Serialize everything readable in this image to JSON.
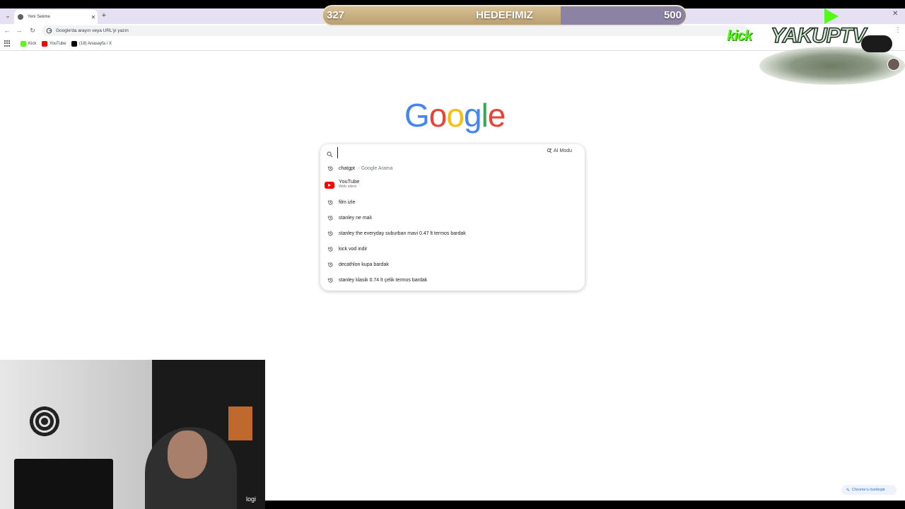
{
  "tab": {
    "title": "Yeni Sekme"
  },
  "omnibox": {
    "placeholder": "Google'da arayın veya URL'yi yazın"
  },
  "bookmarks": [
    {
      "label": "Kick",
      "color": "#53fc18"
    },
    {
      "label": "YouTube",
      "color": "#ff0000"
    },
    {
      "label": "(18) Anasayfa / X",
      "color": "#000000"
    }
  ],
  "overlay": {
    "current": "327",
    "title": "HEDEFIMIZ",
    "goal": "500",
    "progress": 0.654
  },
  "stream_logo": {
    "kick": "kick",
    "name": "YAKUPTV"
  },
  "google": {
    "letters": [
      "G",
      "o",
      "o",
      "g",
      "l",
      "e"
    ],
    "colors": [
      "#4285F4",
      "#EA4335",
      "#FBBC05",
      "#4285F4",
      "#34A853",
      "#EA4335"
    ]
  },
  "search": {
    "value": "",
    "ai_mode_label": "AI Modu",
    "suggestions": [
      {
        "type": "history",
        "text": "chatgpt",
        "sub": "- Google Arama"
      },
      {
        "type": "site",
        "text": "YouTube",
        "sub": "Web sitesi"
      },
      {
        "type": "history",
        "text": "film izle",
        "sub": ""
      },
      {
        "type": "history",
        "text": "stanley ne malı",
        "sub": ""
      },
      {
        "type": "history",
        "text": "stanley the everyday suburban mavi 0.47 lt termos bardak",
        "sub": ""
      },
      {
        "type": "history",
        "text": "kick vod indir",
        "sub": ""
      },
      {
        "type": "history",
        "text": "decathlon kupa bardak",
        "sub": ""
      },
      {
        "type": "history",
        "text": "stanley klasik 0.74 lt çelik termos bardak",
        "sub": ""
      }
    ]
  },
  "webcam": {
    "brand": "logi"
  },
  "customize": {
    "label": "Chrome'u özelleştir"
  }
}
